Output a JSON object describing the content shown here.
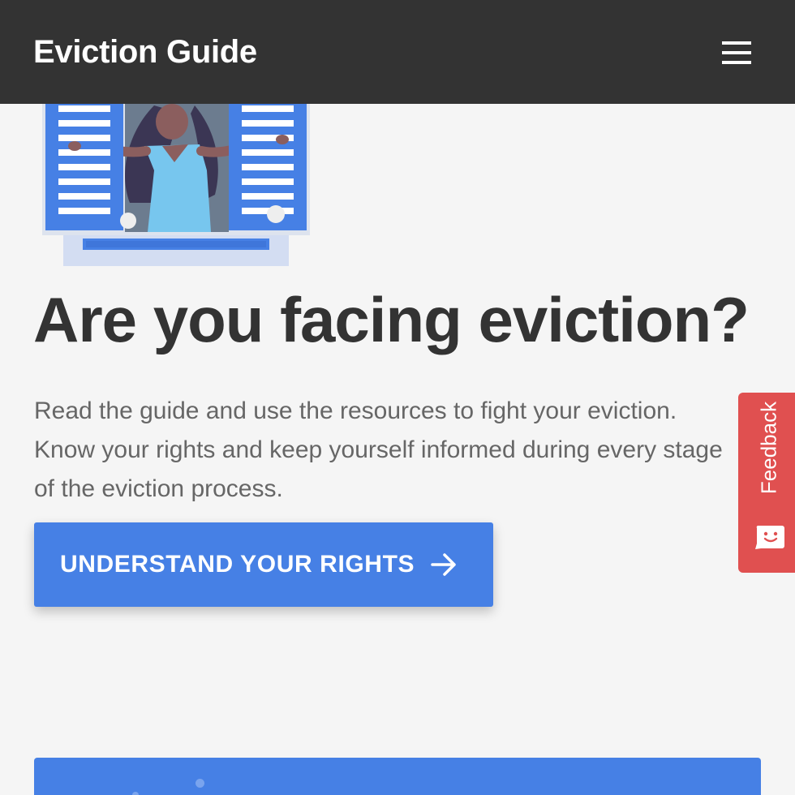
{
  "header": {
    "title": "Eviction Guide",
    "menu_icon": "hamburger-menu-icon"
  },
  "hero": {
    "illustration": "woman-at-window-illustration",
    "headline": "Are you facing eviction?",
    "intro": "Read the guide and use the resources to fight your eviction. Know your rights and keep yourself informed during every stage of the eviction process.",
    "cta_label": "UNDERSTAND YOUR RIGHTS",
    "cta_icon": "arrow-right-icon"
  },
  "feedback": {
    "label": "Feedback",
    "icon": "chat-smile-icon"
  },
  "colors": {
    "topbar": "#333333",
    "background": "#f5f5f5",
    "primary": "#4680e5",
    "feedback": "#e05050",
    "heading_text": "#333333",
    "body_text": "#666666"
  }
}
